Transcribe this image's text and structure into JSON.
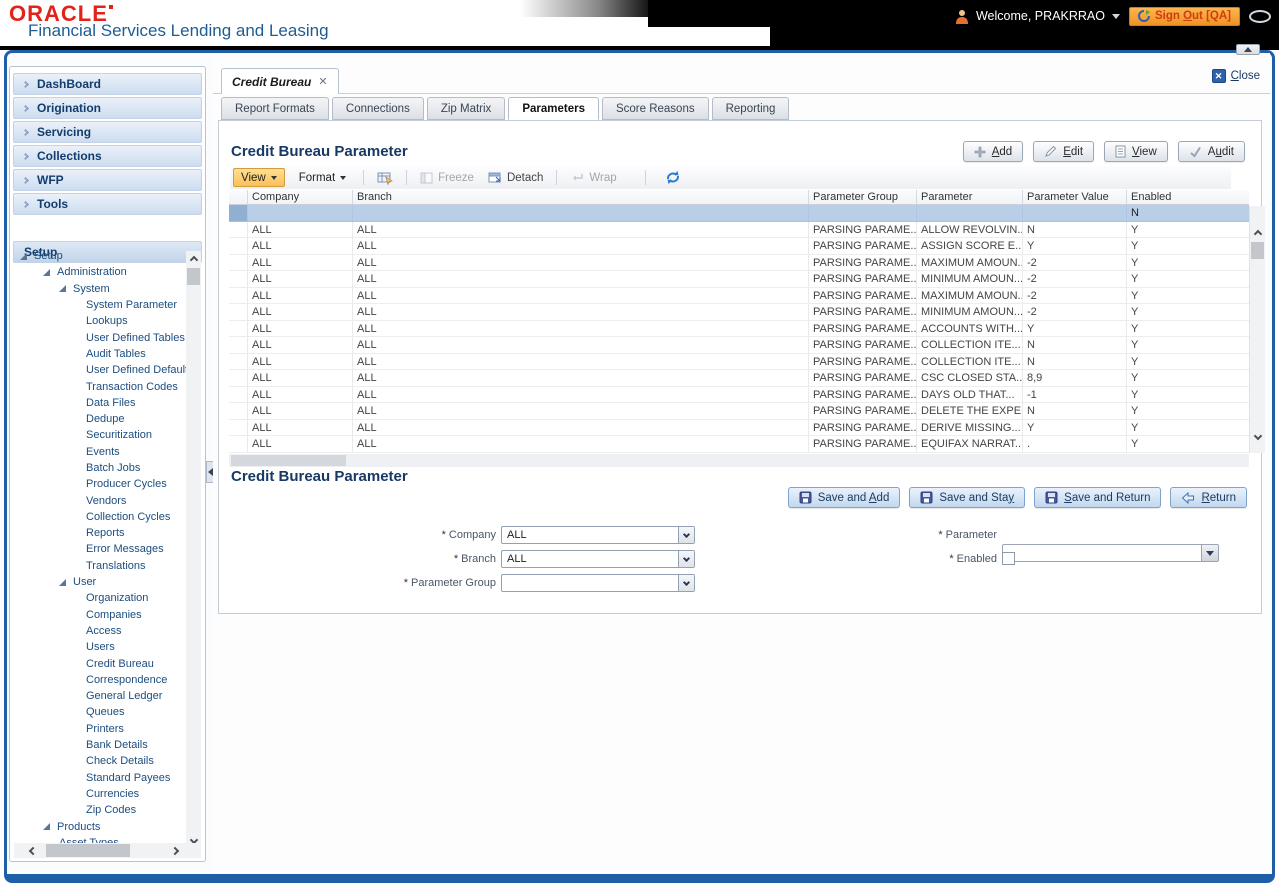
{
  "header": {
    "logo": "ORACLE",
    "subtitle": "Financial Services Lending and Leasing",
    "welcome": "Welcome, PRAKRRAO",
    "sign_out": {
      "label": "Sign Out [QA]",
      "key": "O"
    }
  },
  "colors": {
    "frame_blue": "#1e5fa8",
    "oracle_red": "#e2231a",
    "subtitle_blue": "#1d5c94",
    "signout_orange": "#f19222",
    "selected_row_blue": "#b9cfe7",
    "view_button_orange": "#fbbf59"
  },
  "sidebar": {
    "menu": [
      "DashBoard",
      "Origination",
      "Servicing",
      "Collections",
      "WFP",
      "Tools"
    ],
    "setup_label": "Setup",
    "tree": [
      {
        "label": "Setup",
        "level": 0
      },
      {
        "label": "Administration",
        "level": 1
      },
      {
        "label": "System",
        "level": 2
      },
      {
        "label": "System Parameter",
        "level": 3,
        "leaf": true
      },
      {
        "label": "Lookups",
        "level": 3,
        "leaf": true
      },
      {
        "label": "User Defined Tables",
        "level": 3,
        "leaf": true
      },
      {
        "label": "Audit Tables",
        "level": 3,
        "leaf": true
      },
      {
        "label": "User Defined Default",
        "level": 3,
        "leaf": true
      },
      {
        "label": "Transaction Codes",
        "level": 3,
        "leaf": true
      },
      {
        "label": "Data Files",
        "level": 3,
        "leaf": true
      },
      {
        "label": "Dedupe",
        "level": 3,
        "leaf": true
      },
      {
        "label": "Securitization",
        "level": 3,
        "leaf": true
      },
      {
        "label": "Events",
        "level": 3,
        "leaf": true
      },
      {
        "label": "Batch Jobs",
        "level": 3,
        "leaf": true
      },
      {
        "label": "Producer Cycles",
        "level": 3,
        "leaf": true
      },
      {
        "label": "Vendors",
        "level": 3,
        "leaf": true
      },
      {
        "label": "Collection Cycles",
        "level": 3,
        "leaf": true
      },
      {
        "label": "Reports",
        "level": 3,
        "leaf": true
      },
      {
        "label": "Error Messages",
        "level": 3,
        "leaf": true
      },
      {
        "label": "Translations",
        "level": 3,
        "leaf": true
      },
      {
        "label": "User",
        "level": 2
      },
      {
        "label": "Organization",
        "level": 3,
        "leaf": true
      },
      {
        "label": "Companies",
        "level": 3,
        "leaf": true
      },
      {
        "label": "Access",
        "level": 3,
        "leaf": true
      },
      {
        "label": "Users",
        "level": 3,
        "leaf": true
      },
      {
        "label": "Credit Bureau",
        "level": 3,
        "leaf": true
      },
      {
        "label": "Correspondence",
        "level": 3,
        "leaf": true
      },
      {
        "label": "General Ledger",
        "level": 3,
        "leaf": true
      },
      {
        "label": "Queues",
        "level": 3,
        "leaf": true
      },
      {
        "label": "Printers",
        "level": 3,
        "leaf": true
      },
      {
        "label": "Bank Details",
        "level": 3,
        "leaf": true
      },
      {
        "label": "Check Details",
        "level": 3,
        "leaf": true
      },
      {
        "label": "Standard Payees",
        "level": 3,
        "leaf": true
      },
      {
        "label": "Currencies",
        "level": 3,
        "leaf": true
      },
      {
        "label": "Zip Codes",
        "level": 3,
        "leaf": true
      },
      {
        "label": "Products",
        "level": 1
      },
      {
        "label": "Asset Types",
        "level": 2,
        "leaf": true
      }
    ]
  },
  "tabs": {
    "document_tab": "Credit Bureau",
    "close": {
      "label": "Close",
      "key": "C"
    },
    "subtabs": [
      {
        "label": "Report Formats"
      },
      {
        "label": "Connections"
      },
      {
        "label": "Zip Matrix"
      },
      {
        "label": "Parameters",
        "active": true
      },
      {
        "label": "Score Reasons"
      },
      {
        "label": "Reporting"
      }
    ]
  },
  "grid": {
    "title": "Credit Bureau Parameter",
    "actions": [
      {
        "label": "Add",
        "key": "A"
      },
      {
        "label": "Edit",
        "key": "E"
      },
      {
        "label": "View",
        "key": "V"
      },
      {
        "label": "Audit",
        "key": "u"
      }
    ],
    "toolbar": {
      "view": "View",
      "format": "Format",
      "freeze": "Freeze",
      "detach": "Detach",
      "wrap": "Wrap"
    },
    "columns": [
      "Company",
      "Branch",
      "Parameter Group",
      "Parameter",
      "Parameter Value",
      "Enabled"
    ],
    "selected_row": {
      "company": "",
      "branch": "",
      "group": "",
      "parameter": "",
      "value": "",
      "enabled": "N"
    },
    "rows": [
      {
        "company": "ALL",
        "branch": "ALL",
        "group": "PARSING PARAME...",
        "parameter": "ALLOW REVOLVIN...",
        "value": "N",
        "enabled": "Y"
      },
      {
        "company": "ALL",
        "branch": "ALL",
        "group": "PARSING PARAME...",
        "parameter": "ASSIGN SCORE E...",
        "value": "Y",
        "enabled": "Y"
      },
      {
        "company": "ALL",
        "branch": "ALL",
        "group": "PARSING PARAME...",
        "parameter": "MAXIMUM AMOUN...",
        "value": "-2",
        "enabled": "Y"
      },
      {
        "company": "ALL",
        "branch": "ALL",
        "group": "PARSING PARAME...",
        "parameter": "MINIMUM AMOUN...",
        "value": "-2",
        "enabled": "Y"
      },
      {
        "company": "ALL",
        "branch": "ALL",
        "group": "PARSING PARAME...",
        "parameter": "MAXIMUM AMOUN...",
        "value": "-2",
        "enabled": "Y"
      },
      {
        "company": "ALL",
        "branch": "ALL",
        "group": "PARSING PARAME...",
        "parameter": "MINIMUM AMOUN...",
        "value": "-2",
        "enabled": "Y"
      },
      {
        "company": "ALL",
        "branch": "ALL",
        "group": "PARSING PARAME...",
        "parameter": "ACCOUNTS WITH...",
        "value": "Y",
        "enabled": "Y"
      },
      {
        "company": "ALL",
        "branch": "ALL",
        "group": "PARSING PARAME...",
        "parameter": "COLLECTION ITE...",
        "value": "N",
        "enabled": "Y"
      },
      {
        "company": "ALL",
        "branch": "ALL",
        "group": "PARSING PARAME...",
        "parameter": "COLLECTION ITE...",
        "value": "N",
        "enabled": "Y"
      },
      {
        "company": "ALL",
        "branch": "ALL",
        "group": "PARSING PARAME...",
        "parameter": "CSC CLOSED STA...",
        "value": "8,9",
        "enabled": "Y"
      },
      {
        "company": "ALL",
        "branch": "ALL",
        "group": "PARSING PARAME...",
        "parameter": "DAYS OLD THAT...",
        "value": "-1",
        "enabled": "Y"
      },
      {
        "company": "ALL",
        "branch": "ALL",
        "group": "PARSING PARAME...",
        "parameter": "DELETE THE EXPE...",
        "value": "N",
        "enabled": "Y"
      },
      {
        "company": "ALL",
        "branch": "ALL",
        "group": "PARSING PARAME...",
        "parameter": "DERIVE MISSING...",
        "value": "Y",
        "enabled": "Y"
      },
      {
        "company": "ALL",
        "branch": "ALL",
        "group": "PARSING PARAME...",
        "parameter": "EQUIFAX NARRAT...",
        "value": ".",
        "enabled": "Y"
      }
    ]
  },
  "form": {
    "title": "Credit Bureau Parameter",
    "required_marker": "*",
    "buttons": [
      {
        "label": "Save and Add",
        "key": "A"
      },
      {
        "label": "Save and Stay",
        "key": "y"
      },
      {
        "label": "Save and Return",
        "key": "S"
      },
      {
        "label": "Return",
        "key": "R"
      }
    ],
    "fields": {
      "company": {
        "label": "Company",
        "value": "ALL"
      },
      "branch": {
        "label": "Branch",
        "value": "ALL"
      },
      "parameter_group": {
        "label": "Parameter Group",
        "value": ""
      },
      "parameter": {
        "label": "Parameter",
        "value": ""
      },
      "enabled": {
        "label": "Enabled",
        "checked": false
      }
    }
  }
}
